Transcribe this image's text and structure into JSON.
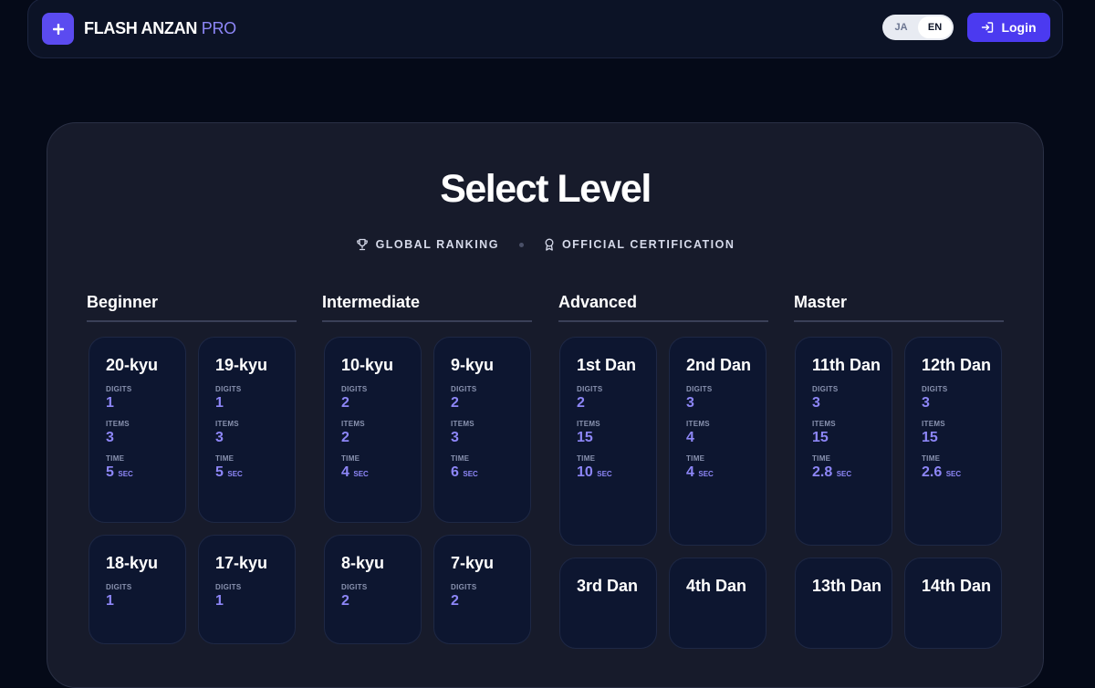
{
  "brand": {
    "name": "FLASH ANZAN",
    "suffix": "PRO"
  },
  "nav": {
    "lang_ja": "JA",
    "lang_en": "EN",
    "login_label": "Login"
  },
  "hero": {
    "title": "Select Level",
    "feature_ranking": "GLOBAL RANKING",
    "feature_cert": "OFFICIAL CERTIFICATION"
  },
  "labels": {
    "digits": "DIGITS",
    "items": "ITEMS",
    "time": "TIME",
    "sec": "SEC"
  },
  "columns": [
    {
      "title": "Beginner",
      "cards": [
        {
          "name": "20-kyu",
          "digits": "1",
          "items": "3",
          "time": "5"
        },
        {
          "name": "19-kyu",
          "digits": "1",
          "items": "3",
          "time": "5"
        },
        {
          "name": "18-kyu",
          "digits": "1"
        },
        {
          "name": "17-kyu",
          "digits": "1"
        }
      ]
    },
    {
      "title": "Intermediate",
      "cards": [
        {
          "name": "10-kyu",
          "digits": "2",
          "items": "2",
          "time": "4"
        },
        {
          "name": "9-kyu",
          "digits": "2",
          "items": "3",
          "time": "6"
        },
        {
          "name": "8-kyu",
          "digits": "2"
        },
        {
          "name": "7-kyu",
          "digits": "2"
        }
      ]
    },
    {
      "title": "Advanced",
      "cards": [
        {
          "name": "1st Dan",
          "digits": "2",
          "items": "15",
          "time": "10"
        },
        {
          "name": "2nd Dan",
          "digits": "3",
          "items": "4",
          "time": "4"
        },
        {
          "name": "3rd Dan"
        },
        {
          "name": "4th Dan"
        }
      ]
    },
    {
      "title": "Master",
      "cards": [
        {
          "name": "11th Dan",
          "digits": "3",
          "items": "15",
          "time": "2.8"
        },
        {
          "name": "12th Dan",
          "digits": "3",
          "items": "15",
          "time": "2.6"
        },
        {
          "name": "13th Dan"
        },
        {
          "name": "14th Dan"
        }
      ]
    }
  ]
}
